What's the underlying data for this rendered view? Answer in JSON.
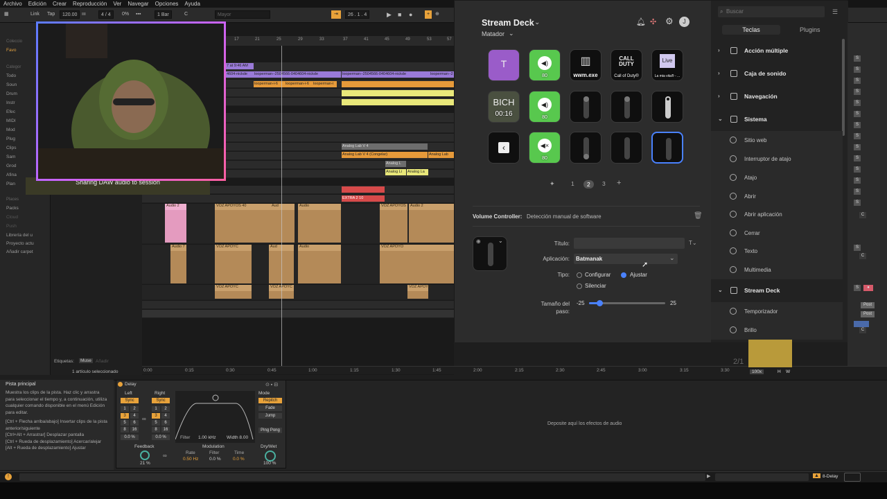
{
  "menu": [
    "Archivo",
    "Edición",
    "Crear",
    "Reproducción",
    "Ver",
    "Navegar",
    "Opciones",
    "Ayuda"
  ],
  "toolbar": {
    "link": "Link",
    "tap": "Tap",
    "tempo": "120.00",
    "sig": "4 / 4",
    "percent": "0%",
    "quant": "1 Bar",
    "key": "C",
    "scale": "Mayor",
    "position": "26 .  1 .  4"
  },
  "browser": {
    "collections": "Coleccio",
    "fav": "Favo",
    "categories": "Categor",
    "items": [
      "Todo",
      "Soun",
      "Drum",
      "Instr",
      "Efec",
      "MIDI",
      "Mod",
      "Plug",
      "Clips",
      "Sam",
      "Grod",
      "Afina",
      "Plan"
    ],
    "places": "Places",
    "place_items": [
      "Packs",
      "Cloud",
      "Push",
      "Librería del u",
      "Proyecto actu",
      "Añadir carpet"
    ],
    "tags_label": "Etiquetas:",
    "tag1": "Muse",
    "tag2": "Añadir",
    "selected": "1 artículo seleccionado"
  },
  "arrangement": {
    "ruler": [
      "17",
      "21",
      "25",
      "29",
      "33",
      "37",
      "41",
      "45",
      "49",
      "53",
      "57"
    ],
    "loop_label": "7 at 9:46 AM",
    "clips": {
      "c1": "4604-nickde",
      "c2": "looperman--2504566-0404604-nickde",
      "c3": "looperman--2504566-0404604-nickde",
      "c4": "looperman--2",
      "o1": "looperman-i-6",
      "o2": "looperman-i-6",
      "o3": "looperman-i",
      "analog1": "Analog Lab V 4",
      "analog2": "Analog Lab V 4 (Congelar)",
      "analog3": "Analog Lab",
      "analog4": "Analog L",
      "analog5": "Analog Li",
      "analog6": "Analog La",
      "extra": "EXTRA 2 10",
      "audio2": "Audio 2",
      "voz1": "VOZ APOYOS 40",
      "voz2": "Aud",
      "voz3": "Aud",
      "voz4": "Audio",
      "voz5": "VOZ APOYOS",
      "voz6": "Audio 2",
      "audio7": "Audio 7",
      "voz7": "VOZ APOYC",
      "voz8": "VOZ APOYO",
      "voz9": "Audio",
      "voz10": "VOZ APOYOS",
      "voz11": "VOZ APOYC",
      "voz12": "VOZ APOYC",
      "voz13": "VOZ APOYC"
    },
    "timeline": [
      "0:00",
      "0:15",
      "0:30",
      "0:45",
      "1:00",
      "1:15",
      "1:30",
      "1:45",
      "2:00",
      "2:15",
      "2:30",
      "2:45",
      "3:00",
      "3:15",
      "3:30"
    ]
  },
  "webcam": {
    "banner": "Sharing DAW audio to session"
  },
  "streamdeck": {
    "title": "Stream Deck",
    "profile": "Matador",
    "keys": [
      {
        "id": "k1",
        "label": "",
        "style": "purple",
        "glyph": "T"
      },
      {
        "id": "k2",
        "label": "80",
        "style": "green",
        "glyph": "◀)"
      },
      {
        "id": "k3",
        "label": "wwm.exe",
        "style": "dark",
        "glyph": "▥"
      },
      {
        "id": "k4",
        "label": "Call of Duty®",
        "style": "dark",
        "glyph": "CALL DUTY"
      },
      {
        "id": "k5",
        "label": "La mia vita® - ...",
        "style": "dark",
        "glyph": "Live"
      },
      {
        "id": "k6",
        "label": "00:16",
        "style": "photo",
        "glyph": "BICH"
      },
      {
        "id": "k7",
        "label": "80",
        "style": "green",
        "glyph": "◀)"
      },
      {
        "id": "k8",
        "label": "",
        "style": "knob",
        "glyph": ""
      },
      {
        "id": "k9",
        "label": "",
        "style": "knob",
        "glyph": ""
      },
      {
        "id": "k10",
        "label": "",
        "style": "knob-top",
        "glyph": ""
      },
      {
        "id": "k11",
        "label": "",
        "style": "back",
        "glyph": "‹"
      },
      {
        "id": "k12",
        "label": "80",
        "style": "green",
        "glyph": "◀×"
      },
      {
        "id": "k13",
        "label": "",
        "style": "knob-bottom",
        "glyph": ""
      },
      {
        "id": "k14",
        "label": "",
        "style": "knob",
        "glyph": ""
      },
      {
        "id": "k15",
        "label": "",
        "style": "knob-sel",
        "glyph": ""
      }
    ],
    "pages": [
      "1",
      "2",
      "3"
    ],
    "active_page": "2",
    "action_title": "Volume Controller:",
    "action_sub": "Detección manual de software",
    "titulo_label": "Título:",
    "titulo_value": "",
    "app_label": "Aplicación:",
    "app_value": "Batmanak",
    "tipo_label": "Tipo:",
    "tipo_options": [
      "Configurar",
      "Ajustar",
      "Silenciar"
    ],
    "tipo_selected": "Ajustar",
    "step_label": "Tamaño del paso:",
    "step_min": "-25",
    "step_max": "25",
    "step_value": -18,
    "search_placeholder": "Buscar",
    "tab_keys": "Teclas",
    "tab_plugins": "Plugins",
    "groups": [
      "Acción múltiple",
      "Caja de sonido",
      "Navegación",
      "Sistema",
      "Stream Deck"
    ],
    "system_items": [
      "Sitio web",
      "Interruptor de atajo",
      "Atajo",
      "Abrir",
      "Abrir aplicación",
      "Cerrar",
      "Texto",
      "Multimedia"
    ],
    "deck_items": [
      "Temporizador",
      "Brillo"
    ]
  },
  "mixer": {
    "page": "2/1",
    "post": "Post",
    "zoom": "100x",
    "h": "H",
    "w": "W"
  },
  "detail": {
    "help_title": "Pista principal",
    "help_body": "Muestra los clips de la pista. Haz clic y arrastra para seleccionar el tiempo y, a continuación, utiliza cualquier comando disponible en el menú Edición para editar.",
    "help_shortcuts": "[Ctrl + Flecha arriba/abajo] Insertar clips de la pista anterior/siguiente\n[Ctrl+Alt + Arrastrar] Desplazar pantalla\n[Ctrl + Rueda de desplazamiento] Acercar/alejar\n[Alt + Rueda de desplazamiento] Ajustar",
    "device": "Delay",
    "left": "Left",
    "right": "Right",
    "sync": "Sync",
    "rows": [
      [
        "1",
        "2"
      ],
      [
        "3",
        "4"
      ],
      [
        "5",
        "6"
      ],
      [
        "8",
        "16"
      ]
    ],
    "left_pct": "0.0 %",
    "right_pct": "0.0 %",
    "filter": "Filter",
    "filter_hz": "1.00 kHz",
    "width": "Width 8.00",
    "mode": "Mode",
    "repitch": "Repitch",
    "fade": "Fade",
    "jump": "Jump",
    "pingpong": "Ping Pong",
    "feedback": "Feedback",
    "feedback_val": "21 %",
    "modulation": "Modulation",
    "rate": "Rate",
    "rate_val": "0.50 Hz",
    "filter2": "Filter",
    "filter2_val": "0.0 %",
    "time": "Time",
    "time_val": "0.0 %",
    "drywet": "Dry/Wet",
    "drywet_val": "100 %",
    "drop_fx": "Deposite aquí los efectos de audio"
  },
  "status": {
    "device_name": "8-Delay"
  }
}
